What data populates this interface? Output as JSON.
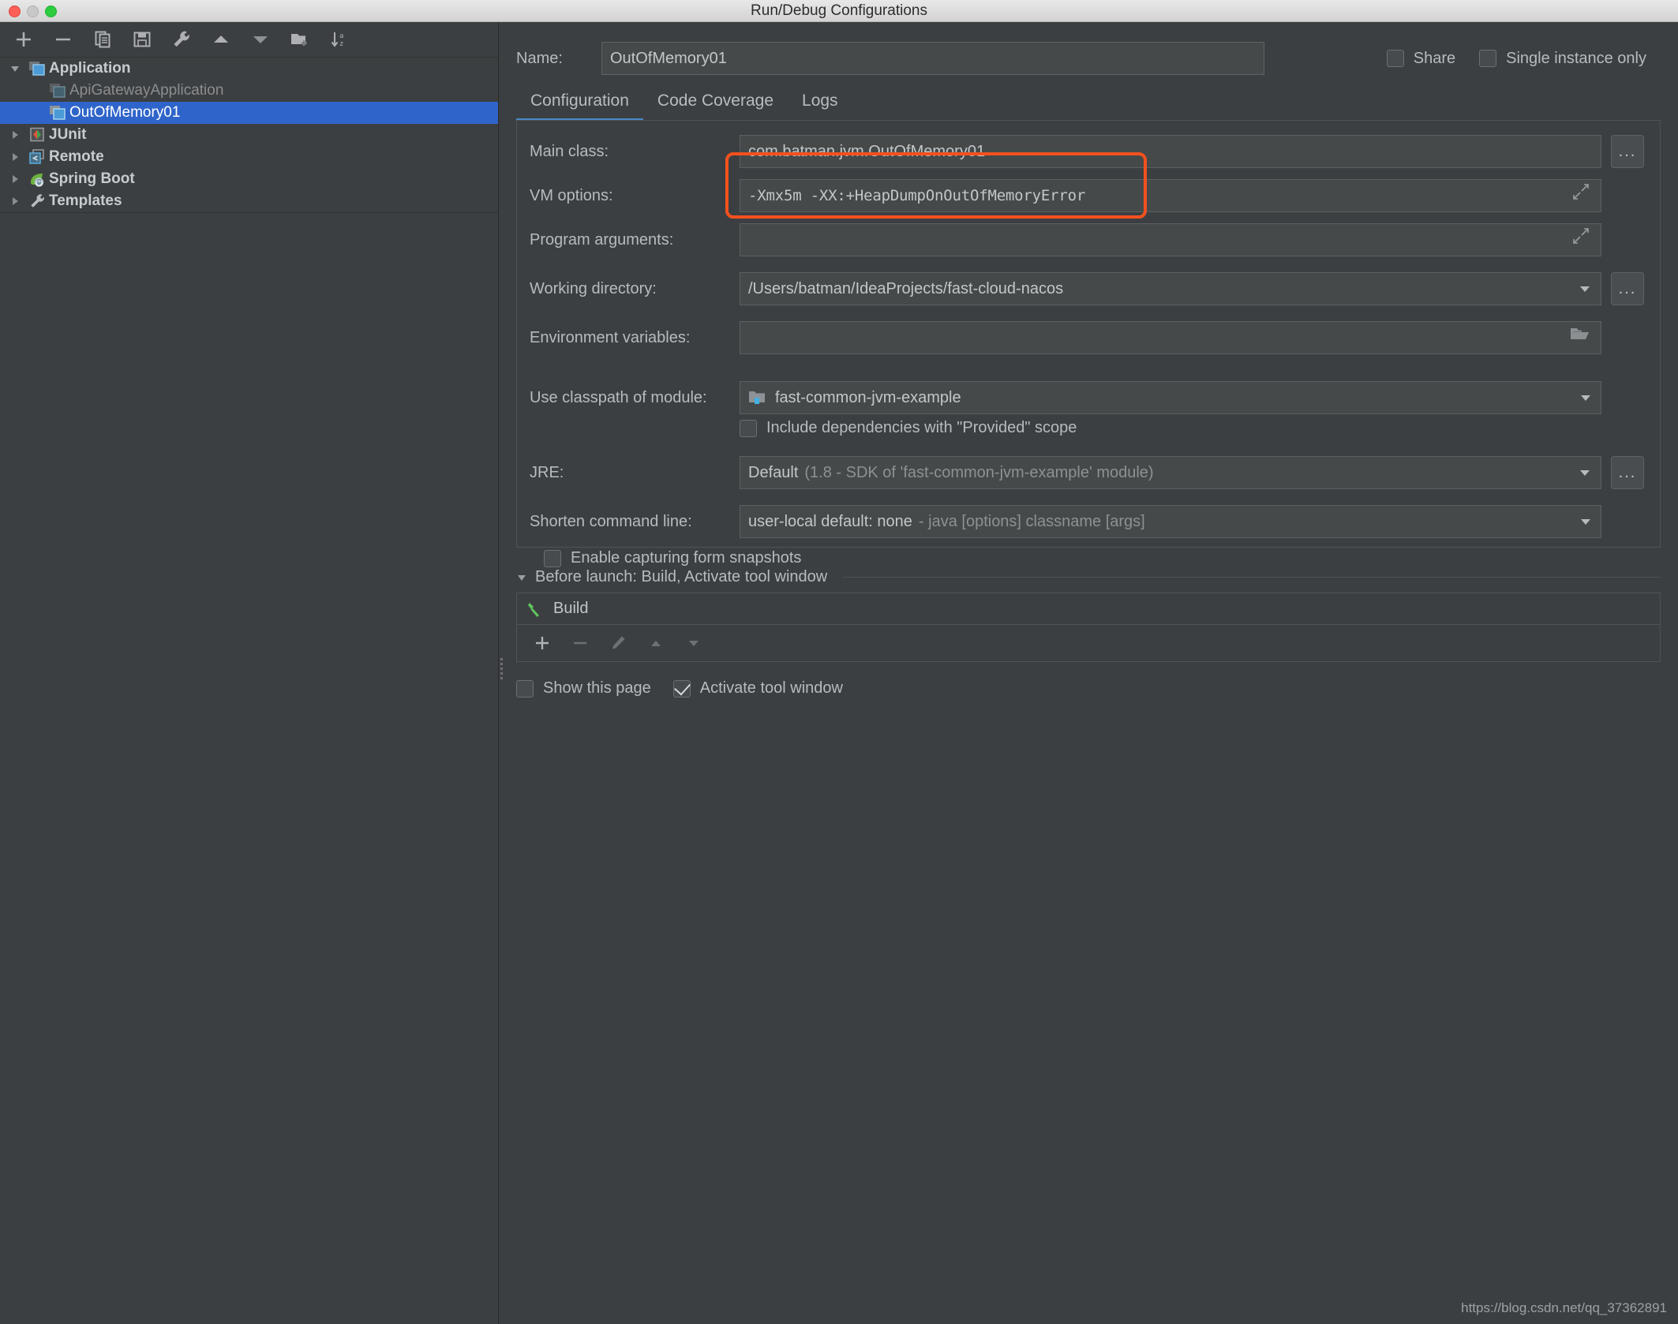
{
  "window": {
    "title": "Run/Debug Configurations",
    "traffic_lights": [
      "close-button",
      "minimize-button",
      "zoom-button"
    ]
  },
  "tree_toolbar": {
    "buttons": [
      {
        "name": "add-configuration-button",
        "icon": "plus-icon",
        "label": "+"
      },
      {
        "name": "remove-configuration-button",
        "icon": "minus-icon",
        "label": "−"
      },
      {
        "name": "copy-configuration-button",
        "icon": "copy-icon",
        "label": "Copy"
      },
      {
        "name": "save-configuration-button",
        "icon": "save-icon",
        "label": "Save"
      },
      {
        "name": "edit-defaults-button",
        "icon": "wrench-icon",
        "label": "Edit defaults"
      },
      {
        "name": "move-up-button",
        "icon": "arrow-up-icon",
        "label": "Move Up"
      },
      {
        "name": "move-down-button",
        "icon": "arrow-down-icon",
        "label": "Move Down"
      },
      {
        "name": "new-folder-button",
        "icon": "new-folder-icon",
        "label": "New Folder"
      },
      {
        "name": "sort-configurations-button",
        "icon": "sort-az-icon",
        "label": "Sort"
      }
    ]
  },
  "tree": {
    "items": [
      {
        "label": "Application",
        "level": 1,
        "expanded": true,
        "icon": "application-icon",
        "state": "group"
      },
      {
        "label": "ApiGatewayApplication",
        "level": 2,
        "expanded": false,
        "icon": "application-icon",
        "state": "dim"
      },
      {
        "label": "OutOfMemory01",
        "level": 2,
        "expanded": false,
        "icon": "application-icon",
        "state": "selected"
      },
      {
        "label": "JUnit",
        "level": 1,
        "expanded": false,
        "icon": "junit-icon",
        "state": "group"
      },
      {
        "label": "Remote",
        "level": 1,
        "expanded": false,
        "icon": "remote-icon",
        "state": "group"
      },
      {
        "label": "Spring Boot",
        "level": 1,
        "expanded": false,
        "icon": "spring-boot-icon",
        "state": "group"
      },
      {
        "label": "Templates",
        "level": 1,
        "expanded": false,
        "icon": "wrench-icon",
        "state": "group"
      }
    ]
  },
  "header": {
    "name_label": "Name:",
    "name_value": "OutOfMemory01",
    "share_label": "Share",
    "share_checked": false,
    "single_instance_label": "Single instance only",
    "single_instance_checked": false
  },
  "tabs": [
    {
      "label": "Configuration",
      "active": true
    },
    {
      "label": "Code Coverage",
      "active": false
    },
    {
      "label": "Logs",
      "active": false
    }
  ],
  "configuration": {
    "main_class": {
      "label": "Main class:",
      "value": "com.batman.jvm.OutOfMemory01",
      "browse_label": "..."
    },
    "vm_options": {
      "label": "VM options:",
      "value": "-Xmx5m  -XX:+HeapDumpOnOutOfMemoryError",
      "highlighted": true
    },
    "program_arguments": {
      "label": "Program arguments:",
      "value": ""
    },
    "working_directory": {
      "label": "Working directory:",
      "value": "/Users/batman/IdeaProjects/fast-cloud-nacos",
      "browse_label": "..."
    },
    "environment_variables": {
      "label": "Environment variables:",
      "value": ""
    },
    "use_classpath_of_module": {
      "label": "Use classpath of module:",
      "value": "fast-common-jvm-example"
    },
    "include_provided": {
      "label": "Include dependencies with \"Provided\" scope",
      "checked": false
    },
    "jre": {
      "label": "JRE:",
      "value": "Default",
      "value_hint": "(1.8 - SDK of 'fast-common-jvm-example' module)",
      "browse_label": "..."
    },
    "shorten_command_line": {
      "label": "Shorten command line:",
      "value": "user-local default: none",
      "value_hint": "- java [options] classname [args]"
    },
    "enable_form_snapshots": {
      "label": "Enable capturing form snapshots",
      "checked": false
    }
  },
  "before_launch": {
    "title": "Before launch: Build, Activate tool window",
    "items": [
      {
        "label": "Build",
        "icon": "hammer-icon"
      }
    ],
    "toolbar": [
      {
        "name": "add-task-button",
        "icon": "plus-icon",
        "enabled": true
      },
      {
        "name": "remove-task-button",
        "icon": "minus-icon",
        "enabled": false
      },
      {
        "name": "edit-task-button",
        "icon": "pencil-icon",
        "enabled": false
      },
      {
        "name": "move-task-up-button",
        "icon": "arrow-up-icon",
        "enabled": false
      },
      {
        "name": "move-task-down-button",
        "icon": "arrow-down-icon",
        "enabled": false
      }
    ],
    "show_this_page": {
      "label": "Show this page",
      "checked": false
    },
    "activate_tool_window": {
      "label": "Activate tool window",
      "checked": true
    }
  },
  "watermark": "https://blog.csdn.net/qq_37362891",
  "colors": {
    "background": "#3c3f41",
    "field_background": "#45494a",
    "selection_blue": "#2f65ca",
    "tab_underline": "#4a88c7",
    "highlight_orange": "#f4511e",
    "text_primary": "#bbbbbb"
  }
}
